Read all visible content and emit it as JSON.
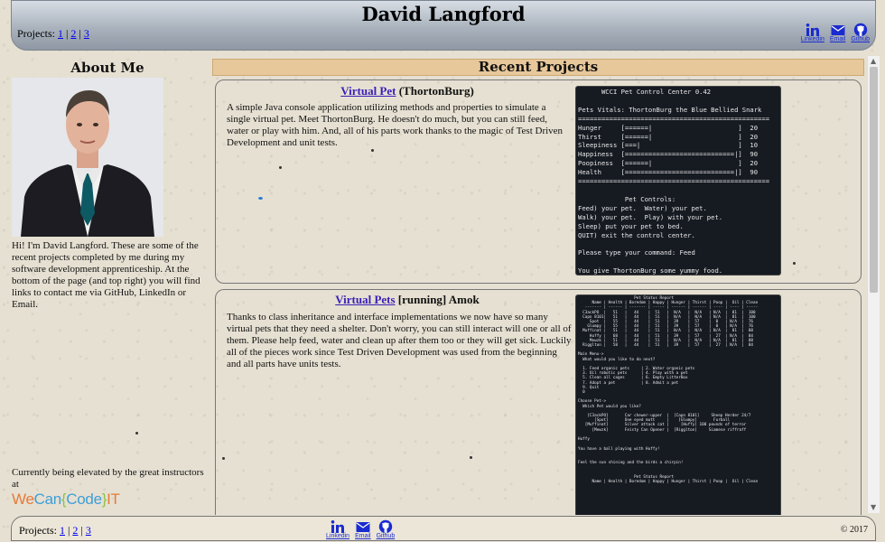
{
  "header": {
    "title": "David Langford",
    "projects_label": "Projects:",
    "project_links": [
      "1",
      "2",
      "3"
    ]
  },
  "social": {
    "linkedin_label": "Linkedin",
    "email_label": "Email",
    "github_label": "Github"
  },
  "sidebar": {
    "about_title": "About Me",
    "about_text": "Hi! I'm David Langford. These are some of the recent projects completed by me during my software development apprenticeship. At the bottom of the page (and top right) you will find links to contact me via GitHub, LinkedIn or Email.",
    "elevated_text": "Currently being elevated by the great instructors at",
    "logo": "WeCan{Code}IT"
  },
  "main": {
    "section_title": "Recent Projects",
    "projects": [
      {
        "link_text": "Virtual Pet",
        "title_rest": " (ThortonBurg)",
        "description": "A simple Java console application utilizing methods and properties to simulate a single virtual pet. Meet ThortonBurg. He doesn't do much, but you can still feed, water or play with him. And, all of his parts work thanks to the magic of Test Driven Development and unit tests.",
        "console": "      WCCI Pet Control Center 0.42\n\nPets Vitals: ThortonBurg the Blue Bellied Snark\n=================================================\nHunger     [======|                      ]  20\nThirst     [======|                      ]  20\nSleepiness [===|                         ]  10\nHappiness  [============================|]  90\nPoopiness  [======|                      ]  20\nHealth     [============================|]  90\n=================================================\n\n            Pet Controls:\nFeed) your pet.  Water) your pet.\nWalk) your pet.  Play) with your pet.\nSleep) put your pet to bed.\nQUIT) exit the control center.\n\nPlease type your command: Feed\n\nYou give ThortonBurg some yummy food."
      },
      {
        "link_text": "Virtual Pets",
        "title_rest": " [running] Amok",
        "description": "Thanks to class inheritance and interface implementations we now have so many virtual pets that they need a shelter. Don't worry, you can still interact will one or all of them. Please help feed, water and clean up after them too or they will get sick. Luckily all of the pieces work since Test Driven Development was used from the beginning and all parts have units tests.",
        "console": "                        Pet Status Report\n      Name | Health | Boredom | Happy | Hunger | Thirst | Poop |  Oil | Clean\n   ------- | ------ | ------- | ----- | ------ | ------ | ---- | ---- | -----\n  C3ackPO  |   51   |   44    |  51   |  N/A   |  N/A   | N/A  |  81  |  100\n  Capn 8101|   51   |   44    |  51   |  N/A   |  N/A   | N/A  |  81  |  100\n     Spot  |   55   |   44    |  51   |  39    |  57    |  0   | N/A  |  76\n    Glumpy |   55   |   44    |  51   |  39    |  57    |  0   | N/A  |  76\n  Muffinat |   51   |   44    |  51   |  N/A   |  N/A   | N/A  |  81  |  88\n     Huffy |   68   |   44    |  51   |  39    |  57    |  27  | N/A  |  84\n     Mewzk |   51   |   44    |  51   |  N/A   |  N/A   | N/A  |  81  |  88\n  Rigglton |   58   |   44    |  51   |  39    |  57    |  27  | N/A  |  84\n\nMain Menu->\n  What would you like to do next?\n\n  1. Feed organic pets     | 2. Water organic pets\n  3. Oil robotic pets      | 4. Play with a pet\n  5. Clean all cages       | 6. Empty LitterBox\n  7. Adopt a pet           | 8. Admit a pet\n  9. Quit\n  0\n\nChoose Pet->\n  Which Pet would you like?\n\n    [C3ackPO]       Car chewer-upper  |  [Capn 8101]     Sheep Herder 24/7\n       [Spot]       One eyed mutt     |    [Glumpy]       Furball\n   [Muffinat]       Silver attack cat |     [Huffy] 100 pounds of terror\n      [Mewzk]       Feisty Can Opener |  [Rigglton]     Siamese riffraff\n\nHuffy\n\nYou have a ball playing with Huffy!\n\n\nFeel the sun shining and the birds a chirpin!\n\n\n                        Pet Status Report\n      Name | Health | Boredom | Happy | Hunger | Thirst | Poop |  Oil | Clean"
      }
    ]
  },
  "footer": {
    "projects_label": "Projects:",
    "project_links": [
      "1",
      "2",
      "3"
    ],
    "copyright": "© 2017"
  }
}
